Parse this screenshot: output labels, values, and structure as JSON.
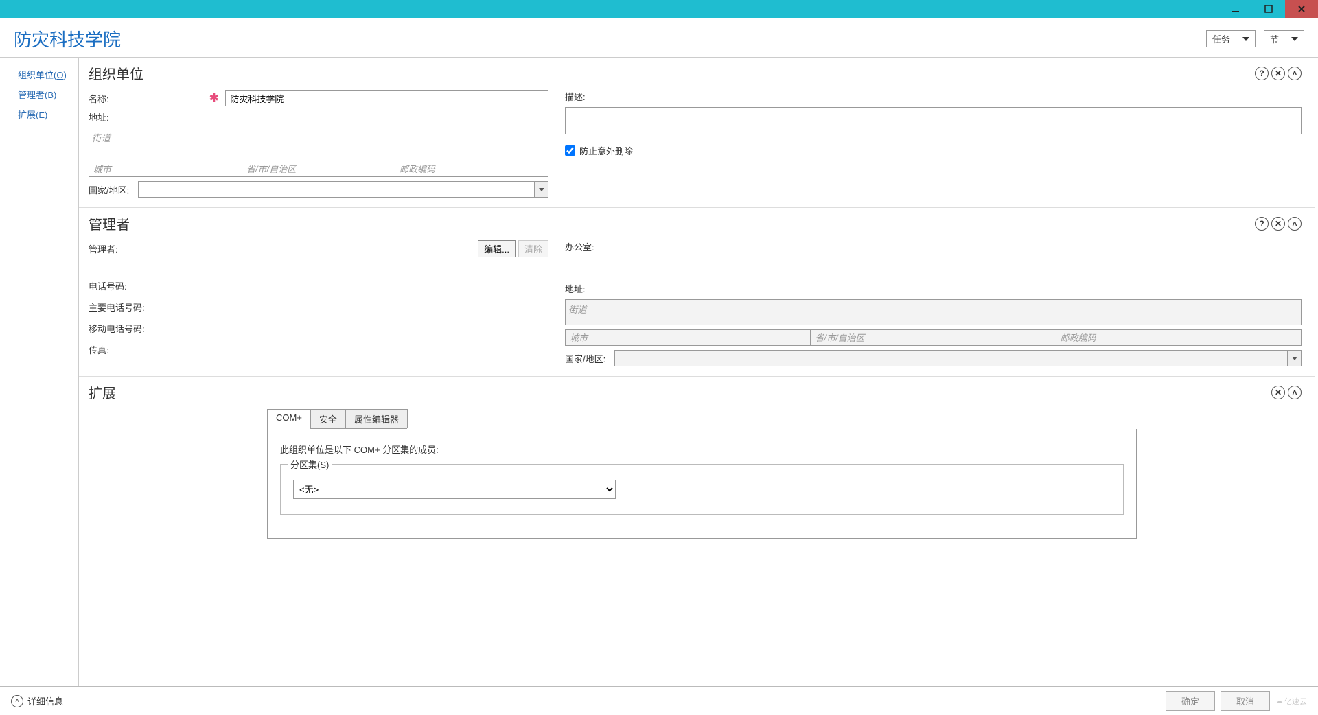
{
  "header": {
    "title": "防灾科技学院",
    "tasks_label": "任务",
    "nodes_label": "节"
  },
  "sidebar": {
    "items": [
      {
        "label": "组织单位(",
        "key": "O",
        "suffix": ")"
      },
      {
        "label": "管理者(",
        "key": "B",
        "suffix": ")"
      },
      {
        "label": "扩展(",
        "key": "E",
        "suffix": ")"
      }
    ]
  },
  "section_ou": {
    "title": "组织单位",
    "name_label": "名称:",
    "name_value": "防灾科技学院",
    "address_label": "地址:",
    "street_placeholder": "街道",
    "city_placeholder": "城市",
    "state_placeholder": "省/市/自治区",
    "zip_placeholder": "邮政编码",
    "country_label": "国家/地区:",
    "desc_label": "描述:",
    "protect_label": "防止意外删除"
  },
  "section_mgr": {
    "title": "管理者",
    "manager_label": "管理者:",
    "edit_btn": "编辑...",
    "clear_btn": "清除",
    "phone_label": "电话号码:",
    "main_phone_label": "主要电话号码:",
    "mobile_label": "移动电话号码:",
    "fax_label": "传真:",
    "office_label": "办公室:",
    "address_label": "地址:",
    "street_placeholder": "街道",
    "city_placeholder": "城市",
    "state_placeholder": "省/市/自治区",
    "zip_placeholder": "邮政编码",
    "country_label": "国家/地区:"
  },
  "section_ext": {
    "title": "扩展",
    "tabs": [
      {
        "label": "COM+"
      },
      {
        "label": "安全"
      },
      {
        "label": "属性编辑器"
      }
    ],
    "com_text": "此组织单位是以下 COM+ 分区集的成员:",
    "partition_label_pre": "分区集(",
    "partition_key": "S",
    "partition_label_post": ")",
    "partition_value": "<无>"
  },
  "footer": {
    "details": "详细信息",
    "ok": "确定",
    "cancel": "取消",
    "watermark": "亿速云"
  },
  "icons": {
    "help": "?",
    "close": "✕",
    "collapse": "˄"
  }
}
